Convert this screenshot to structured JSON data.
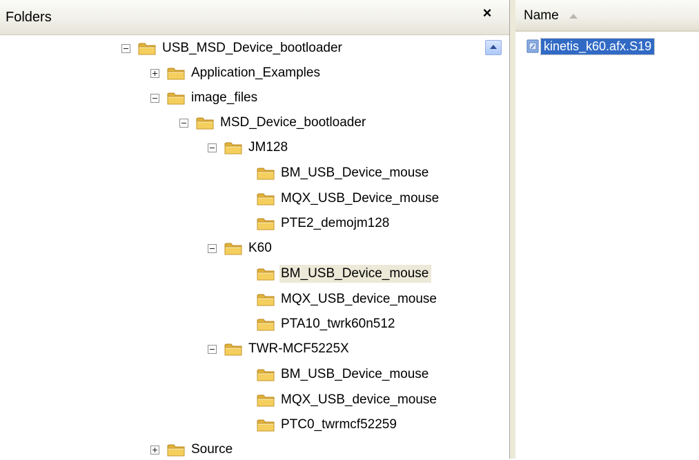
{
  "folders_pane": {
    "title": "Folders",
    "close_label": "×"
  },
  "tree": {
    "items": [
      {
        "label": "USB_MSD_Device_bootloader",
        "expander": "minus"
      },
      {
        "label": "Application_Examples",
        "expander": "plus"
      },
      {
        "label": "image_files",
        "expander": "minus"
      },
      {
        "label": "MSD_Device_bootloader",
        "expander": "minus"
      },
      {
        "label": "JM128",
        "expander": "minus"
      },
      {
        "label": "BM_USB_Device_mouse",
        "expander": "none"
      },
      {
        "label": "MQX_USB_Device_mouse",
        "expander": "none"
      },
      {
        "label": "PTE2_demojm128",
        "expander": "none"
      },
      {
        "label": "K60",
        "expander": "minus"
      },
      {
        "label": "BM_USB_Device_mouse",
        "expander": "none",
        "selected": true
      },
      {
        "label": "MQX_USB_device_mouse",
        "expander": "none"
      },
      {
        "label": "PTA10_twrk60n512",
        "expander": "none"
      },
      {
        "label": "TWR-MCF5225X",
        "expander": "minus"
      },
      {
        "label": "BM_USB_Device_mouse",
        "expander": "none"
      },
      {
        "label": "MQX_USB_device_mouse",
        "expander": "none"
      },
      {
        "label": "PTC0_twrmcf52259",
        "expander": "none"
      },
      {
        "label": "Source",
        "expander": "plus"
      }
    ]
  },
  "files_pane": {
    "column_name": "Name",
    "sort": "ascending",
    "files": [
      {
        "name": "kinetis_k60.afx.S19",
        "selected": true,
        "icon": "s19-file-icon"
      }
    ]
  },
  "colors": {
    "folder": "#f4cf5e",
    "selection": "#316ac5",
    "header_bg": "#f0efe8"
  }
}
